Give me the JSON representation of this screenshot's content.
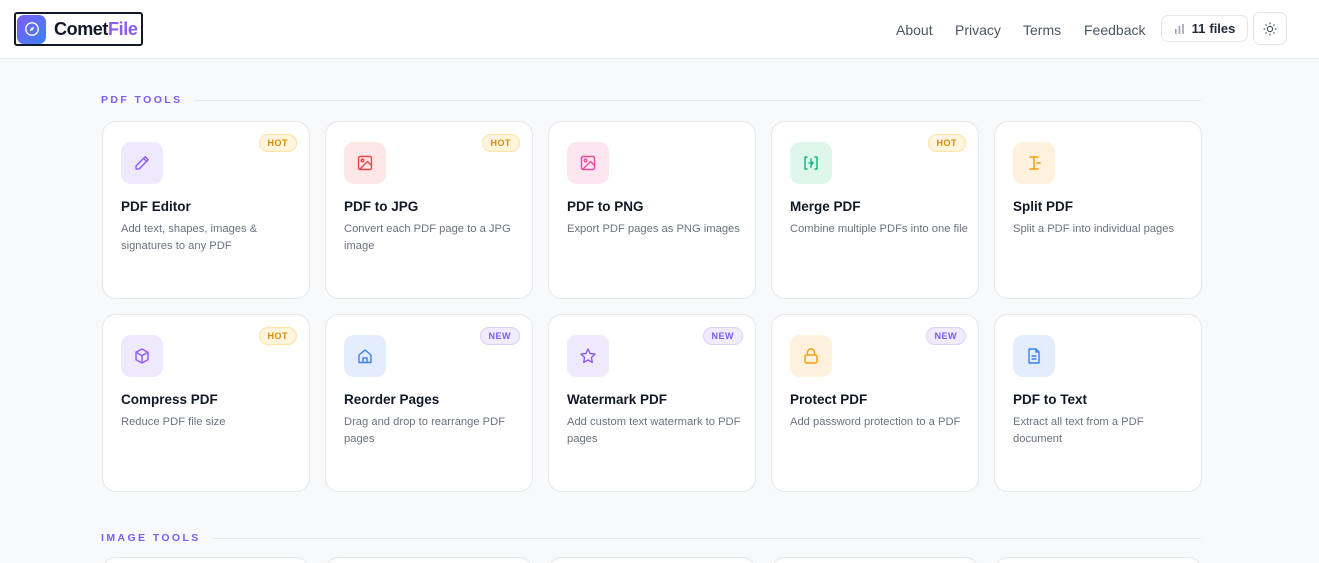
{
  "app": {
    "logo_part1": "Comet",
    "logo_part2": "File"
  },
  "nav": {
    "about": "About",
    "privacy": "Privacy",
    "terms": "Terms",
    "feedback": "Feedback",
    "files_count": "11",
    "files_label": "files",
    "theme_icon": "sun-icon"
  },
  "colors": {
    "accent": "#7c5cf2",
    "hot": "#d98b0c",
    "new": "#7c5cf2"
  },
  "sections": [
    {
      "title": "PDF TOOLS",
      "cards": [
        {
          "title": "PDF Editor",
          "desc": "Add text, shapes, images & signatures to any PDF",
          "badge": "HOT",
          "icon": "pencil-icon"
        },
        {
          "title": "PDF to JPG",
          "desc": "Convert each PDF page to a JPG image",
          "badge": "HOT",
          "icon": "image-icon"
        },
        {
          "title": "PDF to PNG",
          "desc": "Export PDF pages as PNG images",
          "badge": "",
          "icon": "image-icon"
        },
        {
          "title": "Merge PDF",
          "desc": "Combine multiple PDFs into one file",
          "badge": "HOT",
          "icon": "merge-icon"
        },
        {
          "title": "Split PDF",
          "desc": "Split a PDF into individual pages",
          "badge": "",
          "icon": "split-icon"
        },
        {
          "title": "Compress PDF",
          "desc": "Reduce PDF file size",
          "badge": "HOT",
          "icon": "box-icon"
        },
        {
          "title": "Reorder Pages",
          "desc": "Drag and drop to rearrange PDF pages",
          "badge": "NEW",
          "icon": "home-icon"
        },
        {
          "title": "Watermark PDF",
          "desc": "Add custom text watermark to PDF pages",
          "badge": "NEW",
          "icon": "star-icon"
        },
        {
          "title": "Protect PDF",
          "desc": "Add password protection to a PDF",
          "badge": "NEW",
          "icon": "lock-icon"
        },
        {
          "title": "PDF to Text",
          "desc": "Extract all text from a PDF document",
          "badge": "",
          "icon": "document-icon"
        }
      ]
    },
    {
      "title": "IMAGE TOOLS",
      "cards": []
    }
  ]
}
